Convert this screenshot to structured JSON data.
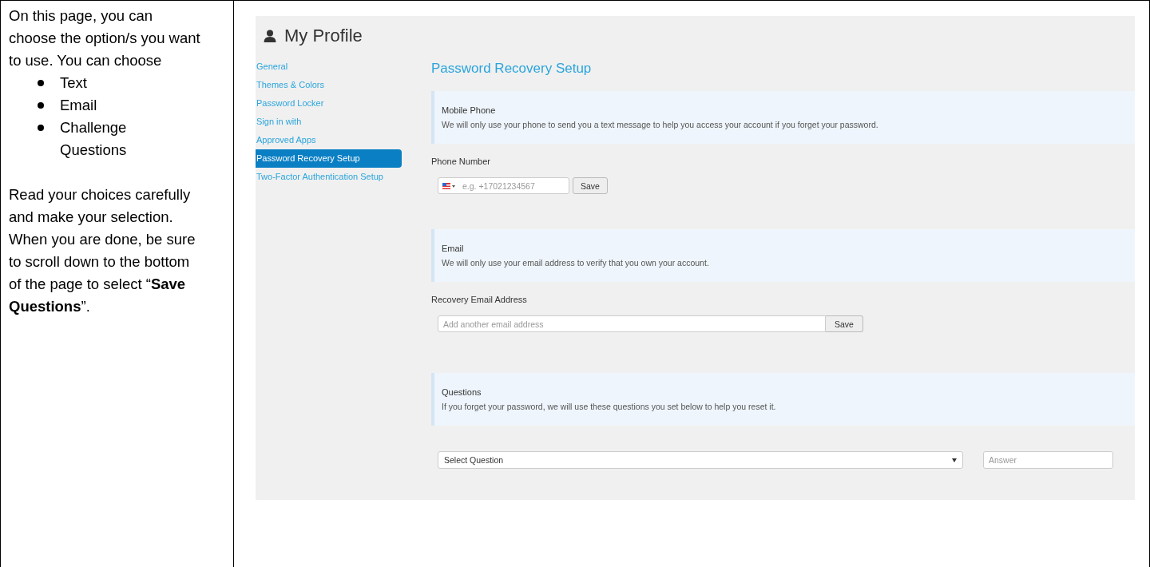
{
  "instructions": {
    "intro": "On this page, you can choose the option/s you want to use.  You can choose",
    "options": [
      "Text",
      "Email",
      "Challenge Questions"
    ],
    "closing": "Read your choices carefully and make your selection. When you are done, be sure to scroll down to the bottom of the page to select “**Save Questions**”."
  },
  "screenshot": {
    "title": "My Profile",
    "nav": [
      {
        "label": "General",
        "selected": false
      },
      {
        "label": "Themes & Colors",
        "selected": false
      },
      {
        "label": "Password Locker",
        "selected": false
      },
      {
        "label": "Sign in with",
        "selected": false
      },
      {
        "label": "Approved Apps",
        "selected": false
      },
      {
        "label": "Password Recovery Setup",
        "selected": true
      },
      {
        "label": "Two-Factor Authentication Setup",
        "selected": false
      }
    ],
    "heading": "Password Recovery Setup",
    "sections": [
      {
        "kind": "phone",
        "title": "Mobile Phone",
        "description": "We will only use your phone to send you a text message to help you access your account if you forget your password.",
        "field_label": "Phone Number",
        "placeholder": "e.g. +17021234567",
        "button": "Save"
      },
      {
        "kind": "email",
        "title": "Email",
        "description": "We will only use your email address to verify that you own your account.",
        "field_label": "Recovery Email Address",
        "placeholder": "Add another email address",
        "button": "Save"
      },
      {
        "kind": "questions",
        "title": "Questions",
        "description": "If you forget your password, we will use these questions you set below to help you reset it.",
        "select": "Select Question",
        "placeholder": "Answer"
      }
    ]
  }
}
